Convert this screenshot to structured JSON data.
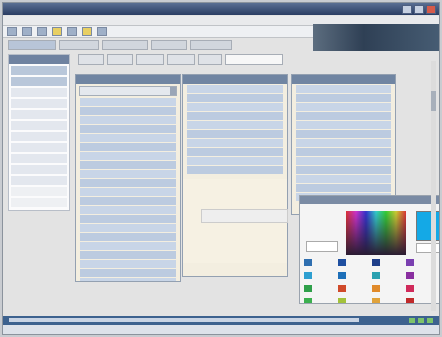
{
  "window": {
    "title": ""
  },
  "menubar": {
    "items": [
      "",
      "",
      "",
      "",
      ""
    ]
  },
  "toolbar": {
    "buttons": [
      "",
      "",
      "",
      "",
      "",
      "",
      ""
    ]
  },
  "banner": {
    "text": ""
  },
  "nav": {
    "items": [
      "",
      "",
      "",
      "",
      ""
    ]
  },
  "sidebar": {
    "items": [
      "",
      "",
      "",
      "",
      "",
      "",
      "",
      "",
      "",
      "",
      "",
      "",
      ""
    ]
  },
  "tabs": [
    "",
    "",
    "",
    "",
    "",
    ""
  ],
  "panels": [
    {
      "title": "",
      "select": "",
      "rows": [
        "",
        "",
        "",
        "",
        "",
        "",
        "",
        "",
        "",
        "",
        "",
        "",
        "",
        "",
        "",
        "",
        "",
        "",
        "",
        "",
        "",
        "",
        ""
      ]
    },
    {
      "title": "",
      "select": "",
      "rows": [
        "",
        "",
        "",
        "",
        "",
        "",
        "",
        "",
        "",
        ""
      ]
    },
    {
      "title": "",
      "select": "",
      "rows": [
        "",
        "",
        "",
        "",
        "",
        "",
        "",
        "",
        "",
        "",
        "",
        "",
        ""
      ]
    }
  ],
  "floater": {
    "text": ""
  },
  "picker": {
    "title": "",
    "preview_color": "#14a9e6",
    "field": "",
    "swatches": [
      {
        "color": "#2f6fb0"
      },
      {
        "color": "#1f4fa0"
      },
      {
        "color": "#1e3f8a"
      },
      {
        "color": "#7a3fb0"
      },
      {
        "color": "#2e9fd0"
      },
      {
        "color": "#1d6fb8"
      },
      {
        "color": "#2aa0b0"
      },
      {
        "color": "#8a2fa0"
      },
      {
        "color": "#2fa04a"
      },
      {
        "color": "#d04a2a"
      },
      {
        "color": "#e08a2a"
      },
      {
        "color": "#d02a5a"
      },
      {
        "color": "#3cb04f"
      },
      {
        "color": "#a3c23a"
      },
      {
        "color": "#e0a23a"
      },
      {
        "color": "#c02a2a"
      }
    ]
  },
  "status": {
    "text": ""
  }
}
